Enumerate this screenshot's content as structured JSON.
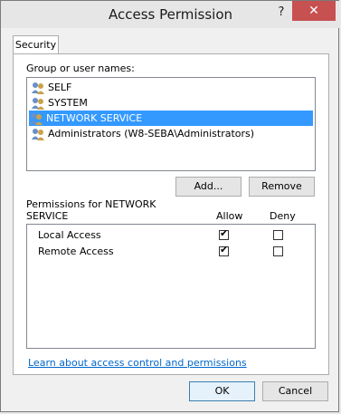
{
  "window": {
    "title": "Access Permission",
    "help_glyph": "?",
    "close_glyph": "✕"
  },
  "tabs": [
    {
      "label": "Security"
    }
  ],
  "group_section": {
    "label": "Group or user names:",
    "users": [
      {
        "name": "SELF"
      },
      {
        "name": "SYSTEM"
      },
      {
        "name": "NETWORK SERVICE",
        "selected": true
      },
      {
        "name": "Administrators (W8-SEBA\\Administrators)"
      }
    ],
    "add_label": "Add...",
    "remove_label": "Remove"
  },
  "permissions": {
    "label_line1": "Permissions for NETWORK",
    "label_line2": "SERVICE",
    "allow_header": "Allow",
    "deny_header": "Deny",
    "rows": [
      {
        "name": "Local Access",
        "allow": true,
        "deny": false
      },
      {
        "name": "Remote Access",
        "allow": true,
        "deny": false
      }
    ]
  },
  "link": {
    "text": "Learn about access control and permissions"
  },
  "footer": {
    "ok_label": "OK",
    "cancel_label": "Cancel"
  },
  "colors": {
    "selection": "#3399ff",
    "close_button": "#c75050",
    "link": "#0066cc"
  }
}
